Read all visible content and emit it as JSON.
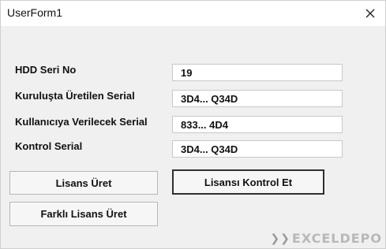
{
  "window": {
    "title": "UserForm1",
    "close_glyph": "×"
  },
  "fields": [
    {
      "label": "HDD Seri No",
      "value": "19"
    },
    {
      "label": "Kuruluşta Üretilen Serial",
      "value": "3D4... Q34D"
    },
    {
      "label": "Kullanıcıya Verilecek Serial",
      "value": "833... 4D4"
    },
    {
      "label": "Kontrol Serial",
      "value": "3D4... Q34D"
    }
  ],
  "buttons": {
    "generate": "Lisans Üret",
    "check": "Lisansı Kontrol Et",
    "other": "Farklı Lisans Üret"
  },
  "watermark": {
    "text": "EXCELDEPO",
    "mark": "❯❯"
  }
}
